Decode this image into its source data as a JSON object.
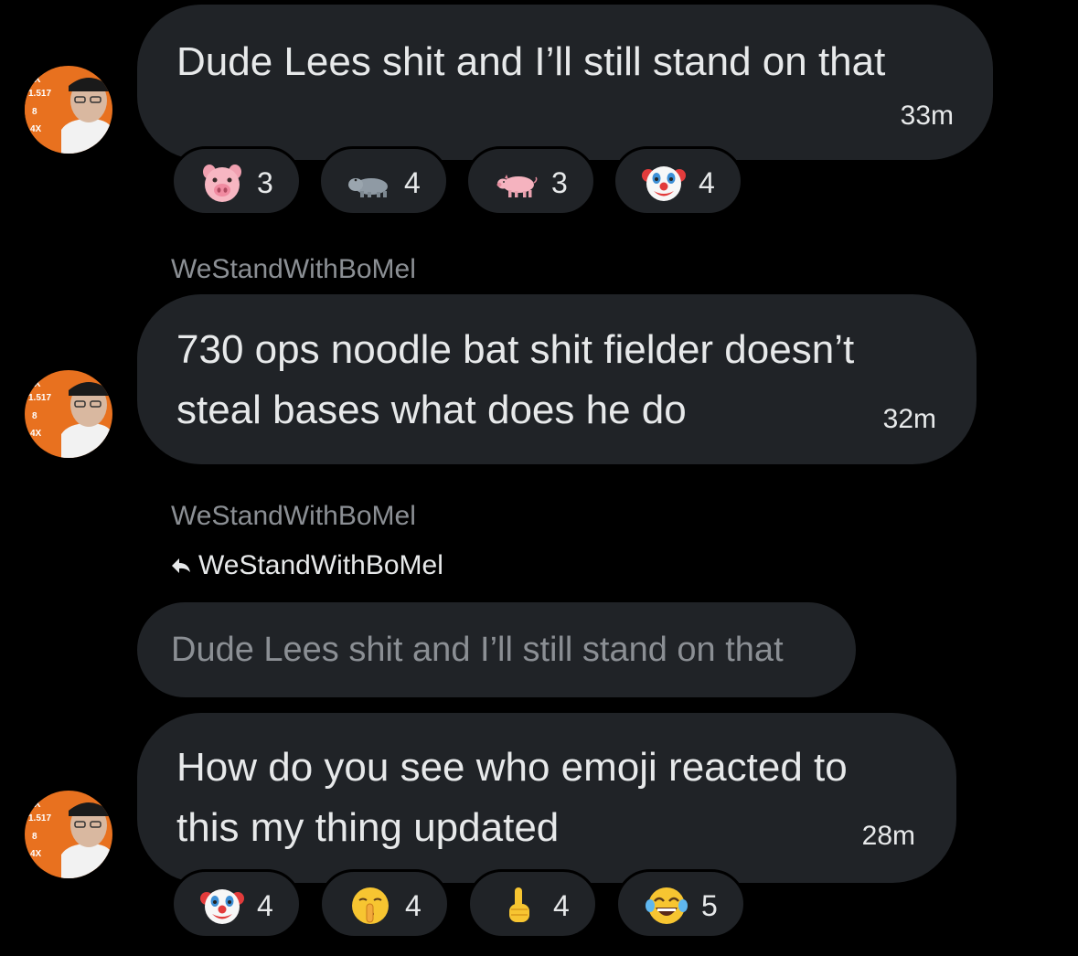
{
  "messages": [
    {
      "text": "Dude Lees shit and I’ll still stand on that",
      "time": "33m",
      "reactions": [
        {
          "emoji": "pig-face-icon",
          "count": "3"
        },
        {
          "emoji": "hippopotamus-icon",
          "count": "4"
        },
        {
          "emoji": "pig-icon",
          "count": "3"
        },
        {
          "emoji": "clown-face-icon",
          "count": "4"
        }
      ]
    },
    {
      "sender": "WeStandWithBoMel",
      "lines": [
        "730 ops noodle bat shit fielder doesn’t",
        "steal bases what does he do"
      ],
      "time": "32m"
    },
    {
      "sender": "WeStandWithBoMel",
      "reply_to": "WeStandWithBoMel",
      "quoted": "Dude Lees shit and I’ll still stand on that",
      "lines": [
        "How do you see who emoji reacted to",
        "this my thing updated"
      ],
      "time": "28m",
      "reactions": [
        {
          "emoji": "clown-face-icon",
          "count": "4"
        },
        {
          "emoji": "shushing-face-icon",
          "count": "4"
        },
        {
          "emoji": "middle-finger-icon",
          "count": "4"
        },
        {
          "emoji": "tears-of-joy-icon",
          "count": "5"
        }
      ]
    }
  ],
  "avatar": {
    "badge_top": "4X",
    "badge_mid": "1.517",
    "badge_num": "8",
    "badge_bottom": "4X",
    "colors": {
      "orange": "#e8711f",
      "skin": "#d9b8a0",
      "background": "#000000",
      "bubble": "#202327"
    }
  }
}
